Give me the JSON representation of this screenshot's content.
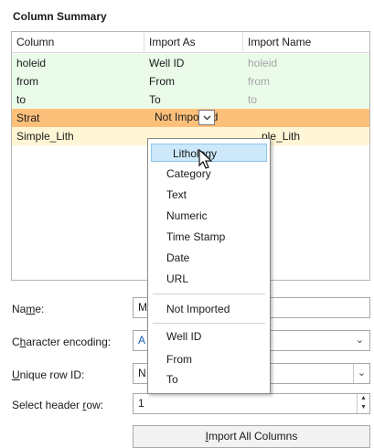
{
  "section_title": "Column Summary",
  "table": {
    "headers": [
      "Column",
      "Import As",
      "Import Name"
    ],
    "rows": [
      {
        "column": "holeid",
        "import_as": "Well ID",
        "import_name": "holeid"
      },
      {
        "column": "from",
        "import_as": "From",
        "import_name": "from"
      },
      {
        "column": "to",
        "import_as": "To",
        "import_name": "to"
      },
      {
        "column": "Strat",
        "import_as": "Not Imported",
        "import_name": ""
      },
      {
        "column": "Simple_Lith",
        "import_as": "",
        "import_name": "ple_Lith"
      }
    ],
    "row_colors": {
      "green": "#eafbea",
      "selected": "#fdc07b",
      "yellow": "#fff6d5"
    }
  },
  "popup_menu": {
    "items": [
      "Lithology",
      "Category",
      "Text",
      "Numeric",
      "Time Stamp",
      "Date",
      "URL"
    ],
    "not_imported": "Not Imported",
    "special": [
      "Well ID",
      "From",
      "To"
    ]
  },
  "form": {
    "name_label_pre": "Na",
    "name_label_u": "m",
    "name_label_post": "e:",
    "name_value": "M",
    "encoding_label_pre": "C",
    "encoding_label_u": "h",
    "encoding_label_post": "aracter encoding:",
    "encoding_value": "A",
    "rowid_label_u": "U",
    "rowid_label_post": "nique row ID:",
    "rowid_value": "N",
    "header_label_pre": "Select header ",
    "header_label_u": "r",
    "header_label_post": "ow:",
    "header_value": "1",
    "import_all_pre": "",
    "import_all_u": "I",
    "import_all_post": "mport All Columns"
  },
  "icons": {
    "dropdown": "chevron-down-icon",
    "pointer": "mouse-pointer-icon"
  }
}
